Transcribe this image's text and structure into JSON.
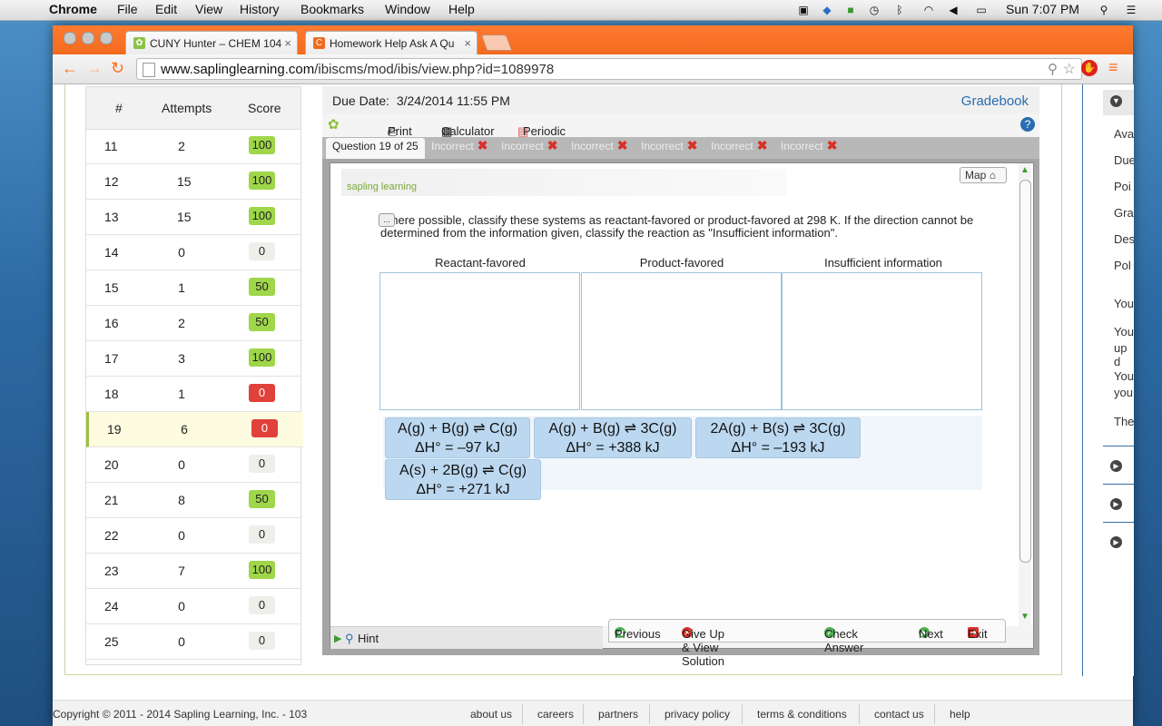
{
  "menubar": {
    "app": "Chrome",
    "items": [
      "File",
      "Edit",
      "View",
      "History",
      "Bookmarks",
      "Window",
      "Help"
    ],
    "clock": "Sun 7:07 PM"
  },
  "tabs": [
    {
      "label": "CUNY Hunter – CHEM 104"
    },
    {
      "label": "Homework Help Ask A Qu"
    }
  ],
  "address": {
    "host": "www.saplinglearning.com",
    "path": "/ibiscms/mod/ibis/view.php?id=1089978"
  },
  "scores": {
    "headers": {
      "num": "#",
      "attempts": "Attempts",
      "score": "Score"
    },
    "rows": [
      {
        "num": "11",
        "attempts": "2",
        "score": "100",
        "status": "good"
      },
      {
        "num": "12",
        "attempts": "15",
        "score": "100",
        "status": "good"
      },
      {
        "num": "13",
        "attempts": "15",
        "score": "100",
        "status": "good"
      },
      {
        "num": "14",
        "attempts": "0",
        "score": "0",
        "status": "none"
      },
      {
        "num": "15",
        "attempts": "1",
        "score": "50",
        "status": "good"
      },
      {
        "num": "16",
        "attempts": "2",
        "score": "50",
        "status": "good"
      },
      {
        "num": "17",
        "attempts": "3",
        "score": "100",
        "status": "good"
      },
      {
        "num": "18",
        "attempts": "1",
        "score": "0",
        "status": "bad"
      },
      {
        "num": "19",
        "attempts": "6",
        "score": "0",
        "status": "bad"
      },
      {
        "num": "20",
        "attempts": "0",
        "score": "0",
        "status": "none"
      },
      {
        "num": "21",
        "attempts": "8",
        "score": "50",
        "status": "good"
      },
      {
        "num": "22",
        "attempts": "0",
        "score": "0",
        "status": "none"
      },
      {
        "num": "23",
        "attempts": "7",
        "score": "100",
        "status": "good"
      },
      {
        "num": "24",
        "attempts": "0",
        "score": "0",
        "status": "none"
      },
      {
        "num": "25",
        "attempts": "0",
        "score": "0",
        "status": "none"
      }
    ]
  },
  "question": {
    "due_label": "Due Date:",
    "due_value": "3/24/2014 11:55 PM",
    "gradebook": "Gradebook",
    "tools": {
      "print": "Print",
      "calculator": "Calculator",
      "periodic": "Periodic Table"
    },
    "tab_active": "Question 19 of 25",
    "tab_incorrect": "Incorrect",
    "logo": "sapling learning",
    "map": "Map",
    "text": "Where possible, classify these systems as reactant-favored or product-favored at 298 K. If the direction cannot be determined from the information given, classify the reaction as \"Insufficient information\".",
    "columns": [
      "Reactant-favored",
      "Product-favored",
      "Insufficient information"
    ],
    "chips": [
      {
        "eq": "A(g) + B(g) ⇌ C(g)",
        "dh": "ΔH° = –97 kJ"
      },
      {
        "eq": "A(g) + B(g) ⇌ 3C(g)",
        "dh": "ΔH° = +388 kJ"
      },
      {
        "eq": "2A(g) + B(s) ⇌ 3C(g)",
        "dh": "ΔH° = –193 kJ"
      },
      {
        "eq": "A(s) + 2B(g) ⇌ C(g)",
        "dh": "ΔH° = +271 kJ"
      }
    ],
    "footer": {
      "hint": "Hint",
      "previous": "Previous",
      "giveup": "Give Up & View Solution",
      "check": "Check Answer",
      "next": "Next",
      "exit": "Exit"
    }
  },
  "right_column": {
    "items": [
      "Ava",
      "Due",
      "Poi",
      "Gra",
      "Des",
      "Pol",
      "You",
      "You",
      "up d",
      "You",
      "you",
      "The"
    ]
  },
  "footer": {
    "copyright": "Copyright © 2011 - 2014 Sapling Learning, Inc. - 103",
    "links": [
      "about us",
      "careers",
      "partners",
      "privacy policy",
      "terms & conditions",
      "contact us",
      "help"
    ]
  }
}
